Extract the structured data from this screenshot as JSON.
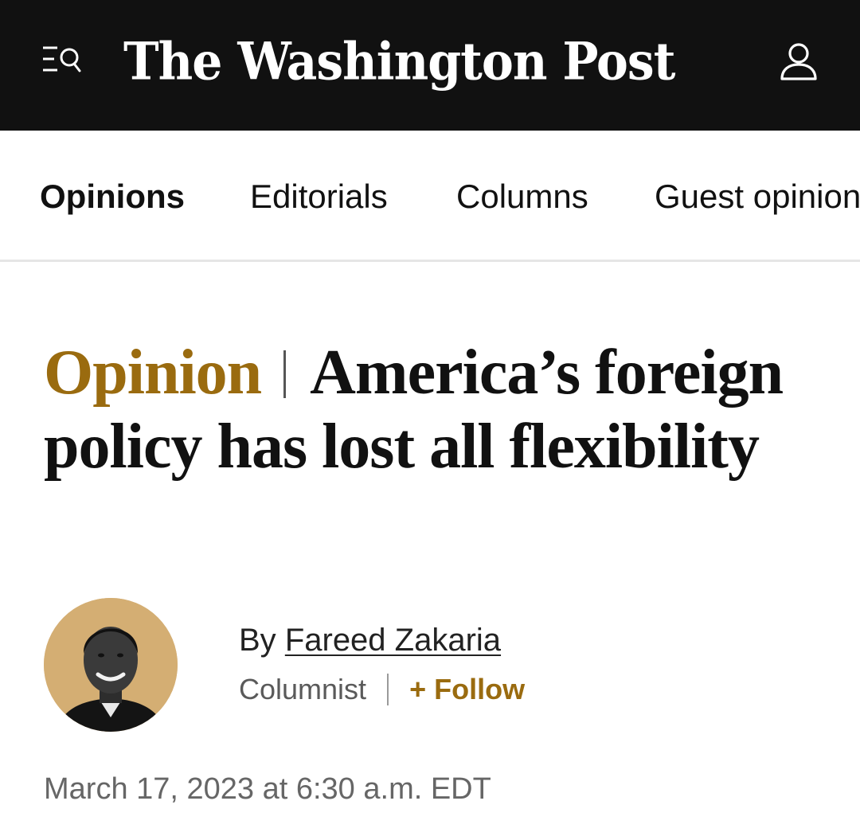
{
  "header": {
    "masthead": "The Washington Post",
    "menu_icon": "menu-search-icon",
    "account_icon": "user-account-icon",
    "background_color": "#111111"
  },
  "section_nav": {
    "items": [
      {
        "label": "Opinions",
        "active": true
      },
      {
        "label": "Editorials",
        "active": false
      },
      {
        "label": "Columns",
        "active": false
      },
      {
        "label": "Guest opinions",
        "active": false
      }
    ]
  },
  "article": {
    "kicker": "Opinion",
    "headline": "America’s foreign policy has lost all flexibility",
    "byline_prefix": "By",
    "author": "Fareed Zakaria",
    "author_role": "Columnist",
    "follow_label": "+ Follow",
    "timestamp": "March 17, 2023 at 6:30 a.m. EDT"
  },
  "colors": {
    "accent": "#9a6b0f",
    "avatar_background": "#d4ae73"
  }
}
